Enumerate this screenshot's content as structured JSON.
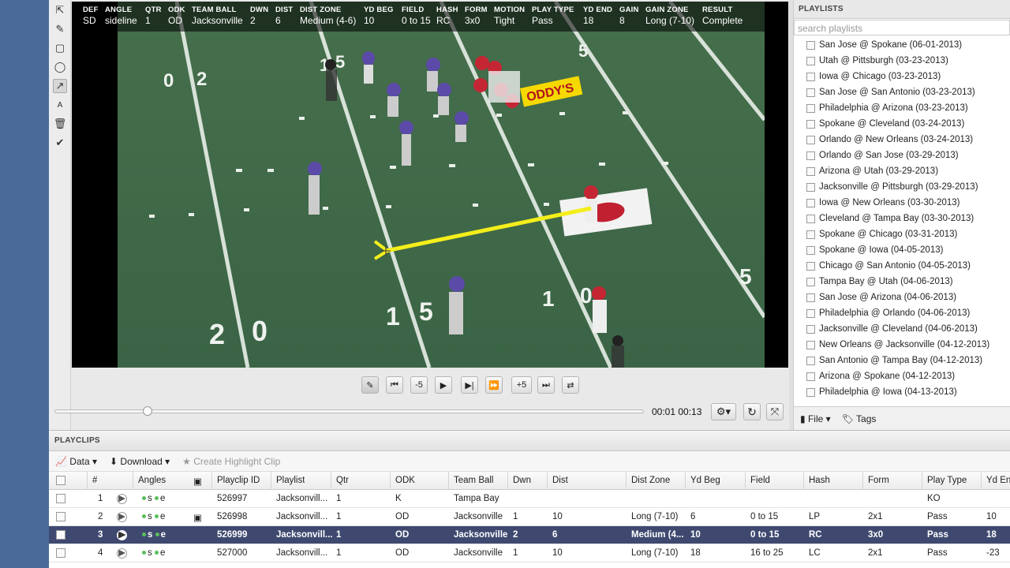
{
  "hud": {
    "columns": [
      {
        "key": "DEF",
        "value": "SD"
      },
      {
        "key": "ANGLE",
        "value": "sideline"
      },
      {
        "key": "QTR",
        "value": "1"
      },
      {
        "key": "ODK",
        "value": "OD"
      },
      {
        "key": "TEAM BALL",
        "value": "Jacksonville"
      },
      {
        "key": "DWN",
        "value": "2"
      },
      {
        "key": "DIST",
        "value": "6"
      },
      {
        "key": "DIST ZONE",
        "value": "Medium (4-6)"
      },
      {
        "key": "YD BEG",
        "value": "10"
      },
      {
        "key": "FIELD",
        "value": "0 to 15"
      },
      {
        "key": "HASH",
        "value": "RC"
      },
      {
        "key": "FORM",
        "value": "3x0"
      },
      {
        "key": "MOTION",
        "value": "Tight"
      },
      {
        "key": "PLAY TYPE",
        "value": "Pass"
      },
      {
        "key": "YD END",
        "value": "18"
      },
      {
        "key": "GAIN",
        "value": "8"
      },
      {
        "key": "GAIN ZONE",
        "value": "Long (7-10)"
      },
      {
        "key": "RESULT",
        "value": "Complete"
      }
    ]
  },
  "field": {
    "numbers": [
      "0",
      "2",
      "0",
      "1",
      "5",
      "0",
      "1",
      "5",
      "0",
      "1",
      "0",
      "5",
      "2",
      "0"
    ],
    "sponsor": "ODDY'S"
  },
  "controls": {
    "back5": "-5",
    "fwd5": "+5",
    "time_current": "00:01",
    "time_total": "00:13"
  },
  "playlists": {
    "title": "PLAYLISTS",
    "search_placeholder": "search playlists",
    "items": [
      "San Jose @ Spokane (06-01-2013)",
      "Utah @ Pittsburgh (03-23-2013)",
      "Iowa @ Chicago (03-23-2013)",
      "San Jose @ San Antonio (03-23-2013)",
      "Philadelphia @ Arizona (03-23-2013)",
      "Spokane @ Cleveland (03-24-2013)",
      "Orlando @ New Orleans (03-24-2013)",
      "Orlando @ San Jose (03-29-2013)",
      "Arizona @ Utah (03-29-2013)",
      "Jacksonville @ Pittsburgh (03-29-2013)",
      "Iowa @ New Orleans (03-30-2013)",
      "Cleveland @ Tampa Bay (03-30-2013)",
      "Spokane @ Chicago (03-31-2013)",
      "Spokane @ Iowa (04-05-2013)",
      "Chicago @ San Antonio (04-05-2013)",
      "Tampa Bay @ Utah (04-06-2013)",
      "San Jose @ Arizona (04-06-2013)",
      "Philadelphia @ Orlando (04-06-2013)",
      "Jacksonville @ Cleveland (04-06-2013)",
      "New Orleans @ Jacksonville (04-12-2013)",
      "San Antonio @ Tampa Bay (04-12-2013)",
      "Arizona @ Spokane (04-12-2013)",
      "Philadelphia @ Iowa (04-13-2013)"
    ],
    "file_label": "File",
    "tags_label": "Tags"
  },
  "playclips": {
    "title": "PLAYCLIPS",
    "data_label": "Data",
    "download_label": "Download",
    "highlight_label": "Create Highlight Clip",
    "headers": [
      "#",
      "Angles",
      "Playclip ID",
      "Playlist",
      "Qtr",
      "ODK",
      "Team Ball",
      "Dwn",
      "Dist",
      "Dist Zone",
      "Yd Beg",
      "Field",
      "Hash",
      "Form",
      "Play Type",
      "Yd End"
    ],
    "rows": [
      {
        "n": "1",
        "angles": "s e",
        "id": "526997",
        "playlist": "Jacksonvill...",
        "qtr": "1",
        "odk": "K",
        "team": "Tampa Bay",
        "dwn": "",
        "dist": "",
        "zone": "",
        "ydbeg": "",
        "field": "",
        "hash": "",
        "form": "",
        "ptype": "KO",
        "ydend": ""
      },
      {
        "n": "2",
        "angles": "s e",
        "id": "526998",
        "playlist": "Jacksonvill...",
        "qtr": "1",
        "odk": "OD",
        "team": "Jacksonville",
        "dwn": "1",
        "dist": "10",
        "zone": "Long (7-10)",
        "ydbeg": "6",
        "field": "0 to 15",
        "hash": "LP",
        "form": "2x1",
        "ptype": "Pass",
        "ydend": "10"
      },
      {
        "n": "3",
        "angles": "s e",
        "id": "526999",
        "playlist": "Jacksonvill...",
        "qtr": "1",
        "odk": "OD",
        "team": "Jacksonville",
        "dwn": "2",
        "dist": "6",
        "zone": "Medium (4...",
        "ydbeg": "10",
        "field": "0 to 15",
        "hash": "RC",
        "form": "3x0",
        "ptype": "Pass",
        "ydend": "18"
      },
      {
        "n": "4",
        "angles": "s e",
        "id": "527000",
        "playlist": "Jacksonvill...",
        "qtr": "1",
        "odk": "OD",
        "team": "Jacksonville",
        "dwn": "1",
        "dist": "10",
        "zone": "Long (7-10)",
        "ydbeg": "18",
        "field": "16 to 25",
        "hash": "LC",
        "form": "2x1",
        "ptype": "Pass",
        "ydend": "-23"
      }
    ],
    "selected_row": 3
  },
  "colors": {
    "accent": "#3f4970",
    "field": "#3f6b49",
    "annotation": "#f4ee1c"
  }
}
